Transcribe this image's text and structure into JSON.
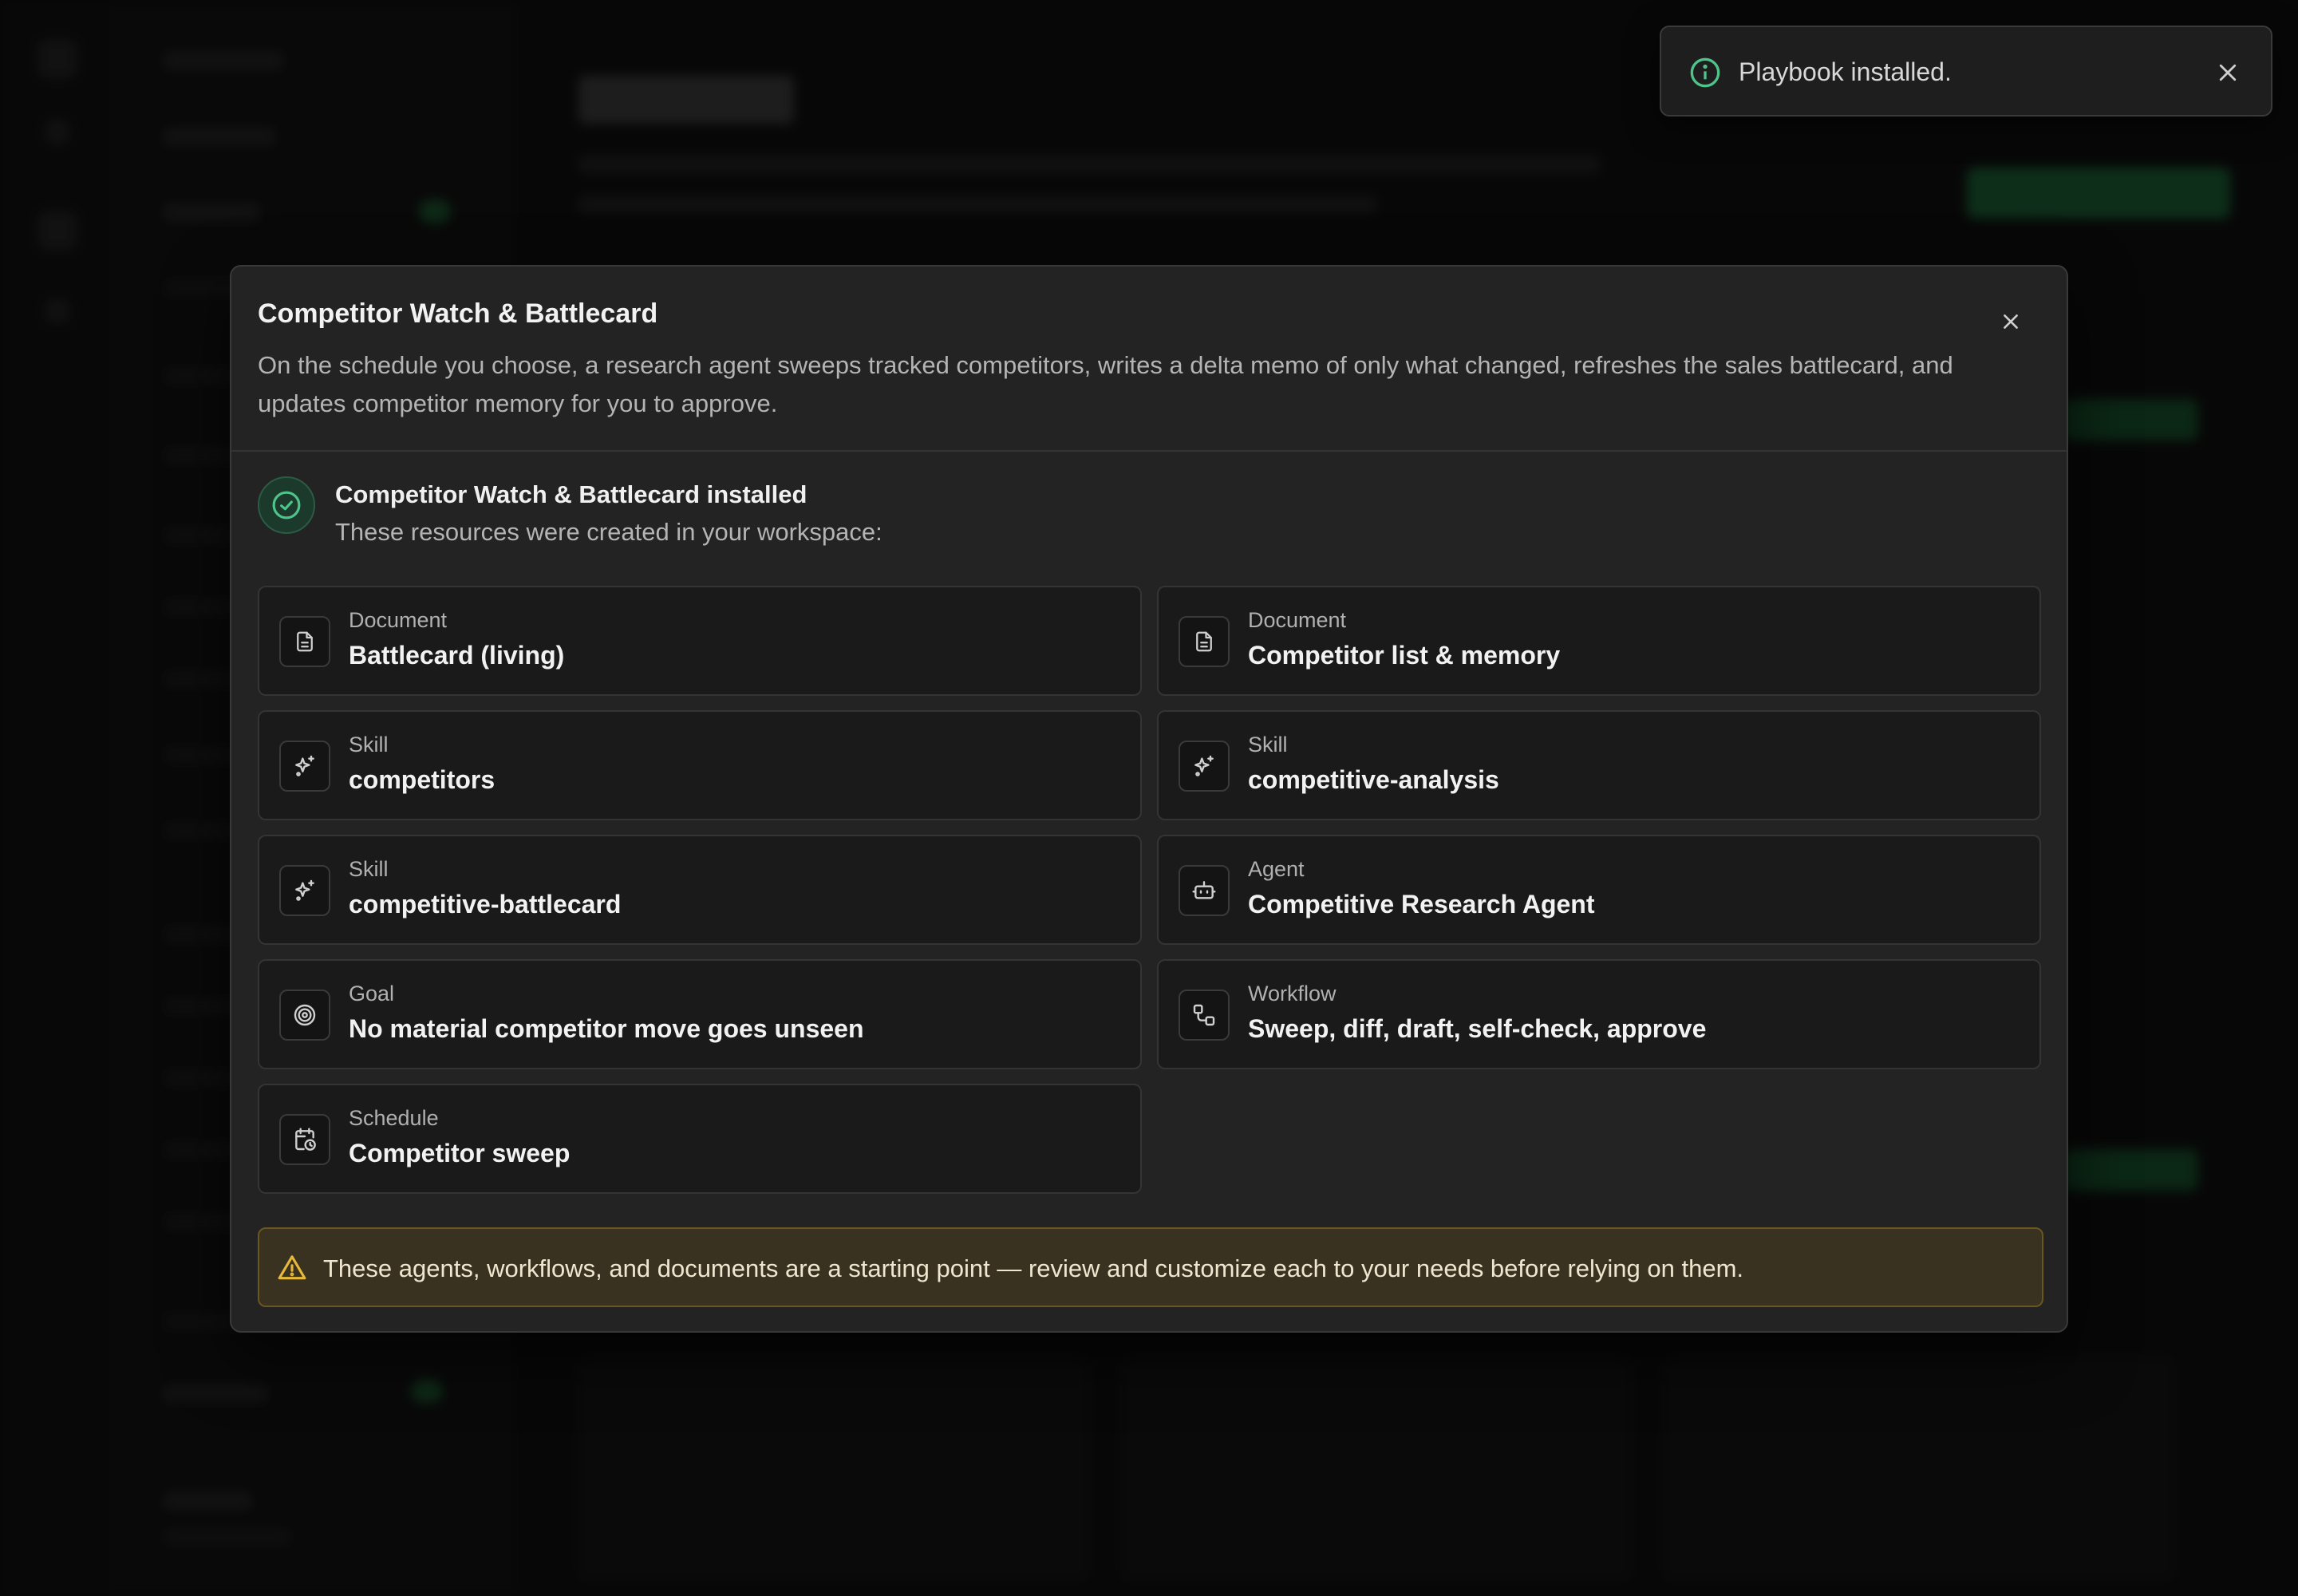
{
  "toast": {
    "message": "Playbook installed.",
    "icon": "info-icon",
    "close_icon": "close-icon"
  },
  "modal": {
    "title": "Competitor Watch & Battlecard",
    "description": "On the schedule you choose, a research agent sweeps tracked competitors, writes a delta memo of only what changed, refreshes the sales battlecard, and updates competitor memory for you to approve.",
    "close_icon": "close-icon",
    "success": {
      "icon": "check-circle-icon",
      "title": "Competitor Watch & Battlecard installed",
      "subtitle": "These resources were created in your workspace:"
    },
    "resources": [
      {
        "type": "Document",
        "name": "Battlecard (living)",
        "icon": "document-icon"
      },
      {
        "type": "Document",
        "name": "Competitor list & memory",
        "icon": "document-icon"
      },
      {
        "type": "Skill",
        "name": "competitors",
        "icon": "sparkles-icon"
      },
      {
        "type": "Skill",
        "name": "competitive-analysis",
        "icon": "sparkles-icon"
      },
      {
        "type": "Skill",
        "name": "competitive-battlecard",
        "icon": "sparkles-icon"
      },
      {
        "type": "Agent",
        "name": "Competitive Research Agent",
        "icon": "robot-icon"
      },
      {
        "type": "Goal",
        "name": "No material competitor move goes unseen",
        "icon": "target-icon"
      },
      {
        "type": "Workflow",
        "name": "Sweep, diff, draft, self-check, approve",
        "icon": "workflow-icon"
      },
      {
        "type": "Schedule",
        "name": "Competitor sweep",
        "icon": "calendar-clock-icon"
      }
    ],
    "warning": {
      "icon": "warning-triangle-icon",
      "text": "These agents, workflows, and documents are a starting point — review and customize each to your needs before relying on them."
    }
  },
  "colors": {
    "success_green": "#4fc48a",
    "warning_yellow": "#e7b93a",
    "modal_bg": "#232323",
    "card_bg": "#1a1a1a"
  }
}
